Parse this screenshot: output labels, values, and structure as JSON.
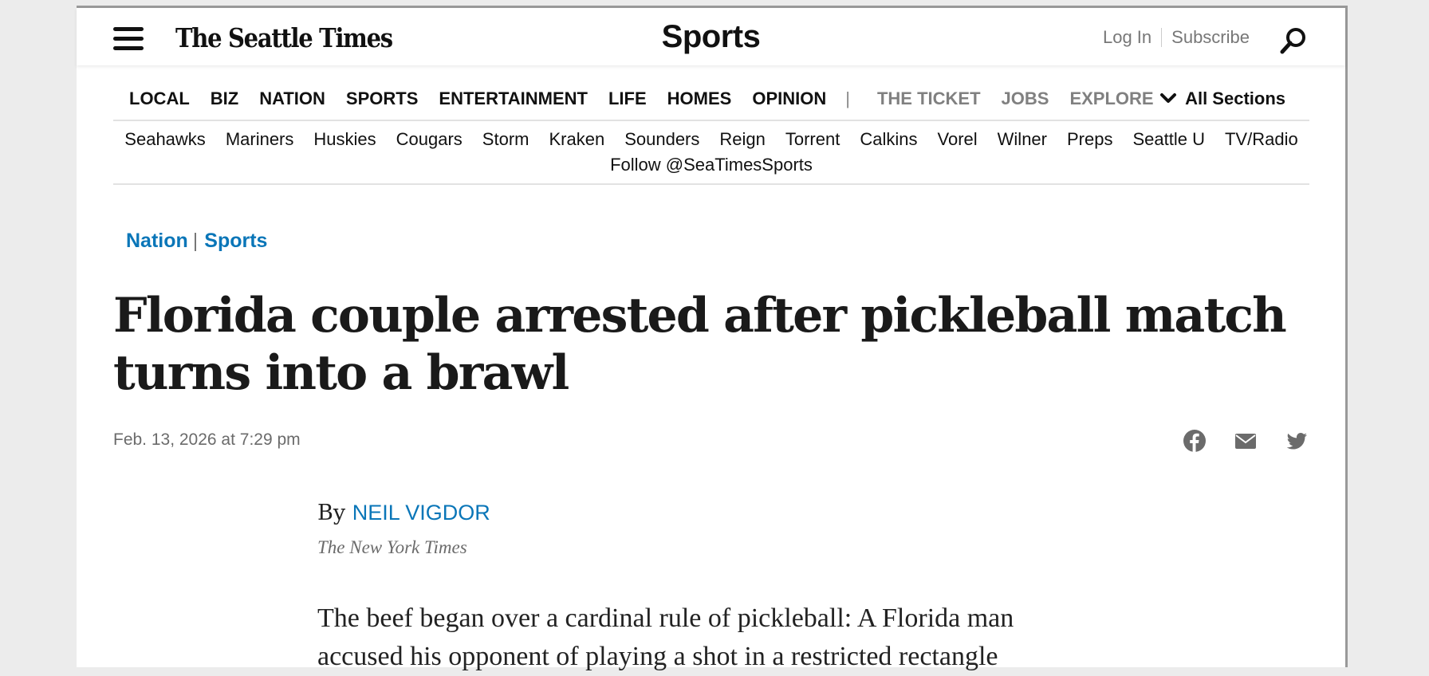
{
  "header": {
    "logo": "The Seattle Times",
    "section_title": "Sports",
    "login": "Log In",
    "subscribe": "Subscribe"
  },
  "primary_nav": {
    "items": [
      "LOCAL",
      "BIZ",
      "NATION",
      "SPORTS",
      "ENTERTAINMENT",
      "LIFE",
      "HOMES",
      "OPINION"
    ],
    "divider": "|",
    "muted_items": [
      "THE TICKET",
      "JOBS",
      "EXPLORE"
    ],
    "all_sections": "All Sections"
  },
  "secondary_nav": {
    "items": [
      "Seahawks",
      "Mariners",
      "Huskies",
      "Cougars",
      "Storm",
      "Kraken",
      "Sounders",
      "Reign",
      "Torrent",
      "Calkins",
      "Vorel",
      "Wilner",
      "Preps",
      "Seattle U",
      "TV/Radio"
    ],
    "follow": "Follow @SeaTimesSports"
  },
  "article": {
    "kickers": [
      "Nation",
      "Sports"
    ],
    "kicker_sep": "|",
    "headline": "Florida couple arrested after pickleball match turns into a brawl",
    "date": "Feb. 13, 2026 at 7:29 pm",
    "byline_prefix": "By",
    "author": "NEIL VIGDOR",
    "source": "The New York Times",
    "body_line1": "The beef began over a cardinal rule of pickleball: A Florida man",
    "body_line2": "accused his opponent of playing a shot in a restricted rectangle"
  },
  "colors": {
    "link_blue": "#0a76b8",
    "muted_gray": "#808080",
    "text_dark": "#1a1a1a"
  },
  "icons": {
    "menu": "hamburger-icon",
    "search": "search-icon",
    "share": [
      "facebook-icon",
      "email-icon",
      "twitter-icon"
    ],
    "chevron": "chevron-down-icon"
  }
}
